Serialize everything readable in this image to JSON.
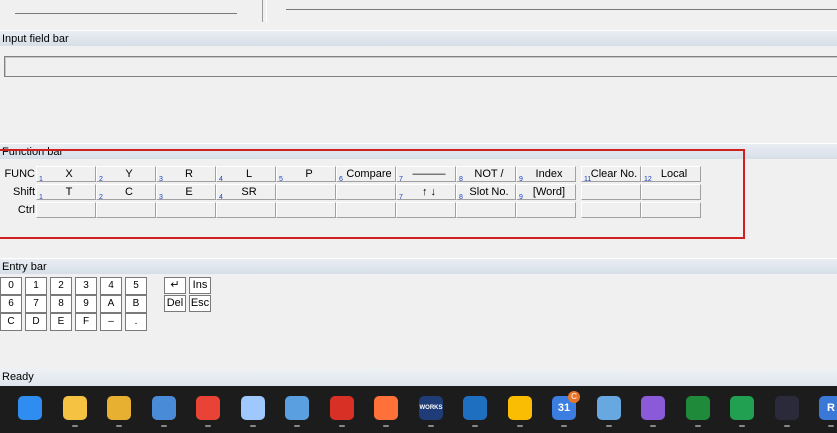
{
  "sections": {
    "input_bar": "Input field bar",
    "function_bar": "Function bar",
    "entry_bar": "Entry bar"
  },
  "status": "Ready",
  "function_bar": {
    "row_labels": [
      "FUNC",
      "Shift",
      "Ctrl"
    ],
    "func_keys": [
      {
        "num": "1",
        "label": "X"
      },
      {
        "num": "2",
        "label": "Y"
      },
      {
        "num": "3",
        "label": "R"
      },
      {
        "num": "4",
        "label": "L"
      },
      {
        "num": "5",
        "label": "P"
      },
      {
        "num": "6",
        "label": "Compare"
      },
      {
        "num": "7",
        "label": "———"
      },
      {
        "num": "8",
        "label": "NOT /"
      },
      {
        "num": "9",
        "label": "Index"
      },
      {
        "num": "11",
        "label": "Clear No."
      },
      {
        "num": "12",
        "label": "Local"
      }
    ],
    "shift_keys": [
      {
        "num": "1",
        "label": "T"
      },
      {
        "num": "2",
        "label": "C"
      },
      {
        "num": "3",
        "label": "E"
      },
      {
        "num": "4",
        "label": "SR"
      },
      {
        "num": "",
        "label": ""
      },
      {
        "num": "",
        "label": ""
      },
      {
        "num": "7",
        "label": "↑ ↓"
      },
      {
        "num": "8",
        "label": "Slot No."
      },
      {
        "num": "9",
        "label": "[Word]"
      },
      {
        "num": "",
        "label": ""
      },
      {
        "num": "",
        "label": ""
      }
    ]
  },
  "entry_bar": {
    "rows": [
      [
        "0",
        "1",
        "2",
        "3",
        "4",
        "5"
      ],
      [
        "6",
        "7",
        "8",
        "9",
        "A",
        "B"
      ],
      [
        "C",
        "D",
        "E",
        "F",
        "–",
        "."
      ]
    ],
    "side_keys": [
      [
        "↵",
        "Ins"
      ],
      [
        "Del",
        "Esc"
      ]
    ]
  },
  "taskbar": {
    "icons": [
      {
        "name": "windows-start-icon",
        "color": "#2f8cf0"
      },
      {
        "name": "file-explorer-icon",
        "color": "#f5c242"
      },
      {
        "name": "network-tool-icon",
        "color": "#e8b030"
      },
      {
        "name": "remote-desktop-icon",
        "color": "#4a8bd8"
      },
      {
        "name": "chrome-icon",
        "color": "#e94335"
      },
      {
        "name": "virtualbox-icon",
        "color": "#9fc8ff"
      },
      {
        "name": "network-settings-icon",
        "color": "#5aa0e0"
      },
      {
        "name": "gmail-icon",
        "color": "#d93025"
      },
      {
        "name": "firefox-icon",
        "color": "#ff7139"
      },
      {
        "name": "works-app-icon",
        "color": "#1f3c78",
        "text": "WORKS"
      },
      {
        "name": "wireshark-icon",
        "color": "#1f6fc0"
      },
      {
        "name": "google-drive-icon",
        "color": "#fbbc04"
      },
      {
        "name": "calendar-icon",
        "color": "#3b7de0",
        "text": "31"
      },
      {
        "name": "monitor-app-icon",
        "color": "#68a8e0"
      },
      {
        "name": "chat-app-icon",
        "color": "#8a5ad8"
      },
      {
        "name": "xbox-icon",
        "color": "#1e8a3a"
      },
      {
        "name": "google-chat-icon",
        "color": "#20a050"
      },
      {
        "name": "app-icon",
        "color": "#2a2a3a"
      },
      {
        "name": "r-app-icon",
        "color": "#3a78d8",
        "text": "R"
      }
    ],
    "badge": "C"
  }
}
